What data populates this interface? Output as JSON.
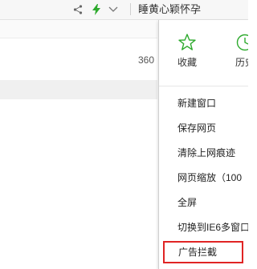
{
  "toolbar": {
    "search_text": "睡黄心颖怀孕",
    "icons": [
      "share-icon",
      "flash-icon",
      "chevron-down-icon"
    ]
  },
  "background": {
    "text_360": "360"
  },
  "menu": {
    "quick": [
      {
        "icon": "star-icon",
        "label": "收藏"
      },
      {
        "icon": "history-icon",
        "label": "历史"
      }
    ],
    "items": [
      {
        "label": "新建窗口"
      },
      {
        "label": "保存网页"
      },
      {
        "label": "清除上网痕迹"
      },
      {
        "label": "网页缩放（100"
      },
      {
        "label": "全屏"
      },
      {
        "label": "切换到IE6多窗口"
      },
      {
        "label": "广告拦截"
      }
    ],
    "accent_color": "#2eaa2e",
    "highlight_color": "#e02424"
  }
}
